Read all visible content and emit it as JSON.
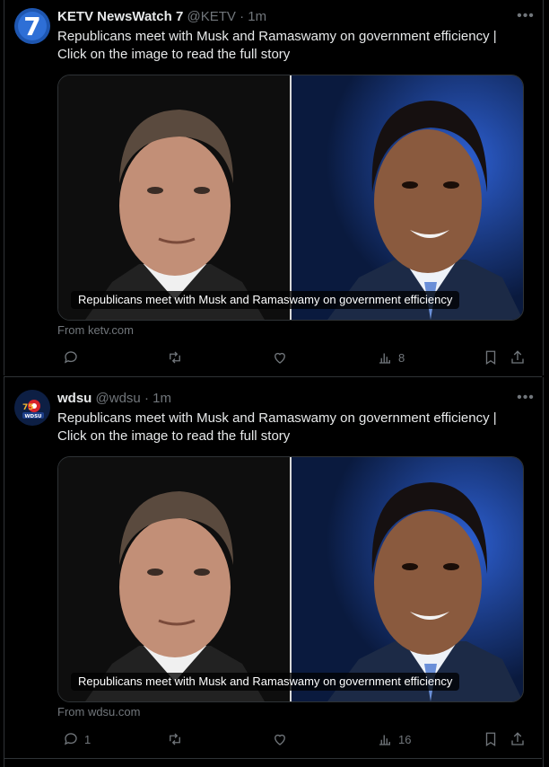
{
  "tweets": [
    {
      "account_name": "KETV NewsWatch 7",
      "handle": "@KETV",
      "separator": "·",
      "time": "1m",
      "text": "Republicans meet with Musk and Ramaswamy on government efficiency | Click on the image to read the full story",
      "card_caption": "Republicans meet with Musk and Ramaswamy on government efficiency",
      "source": "From ketv.com",
      "avatar_label": "7",
      "reply_count": "",
      "retweet_count": "",
      "like_count": "",
      "view_count": "8"
    },
    {
      "account_name": "wdsu",
      "handle": "@wdsu",
      "separator": "·",
      "time": "1m",
      "text": "Republicans meet with Musk and Ramaswamy on government efficiency | Click on the image to read the full story",
      "card_caption": "Republicans meet with Musk and Ramaswamy on government efficiency",
      "source": "From wdsu.com",
      "avatar_label": "WDSU",
      "reply_count": "1",
      "retweet_count": "",
      "like_count": "",
      "view_count": "16"
    }
  ],
  "icons": [
    "more-icon",
    "reply-icon",
    "retweet-icon",
    "like-icon",
    "views-icon",
    "bookmark-icon",
    "share-icon"
  ],
  "colors": {
    "background": "#000000",
    "text": "#e7e9ea",
    "muted": "#71767b",
    "border": "#2f3336"
  }
}
